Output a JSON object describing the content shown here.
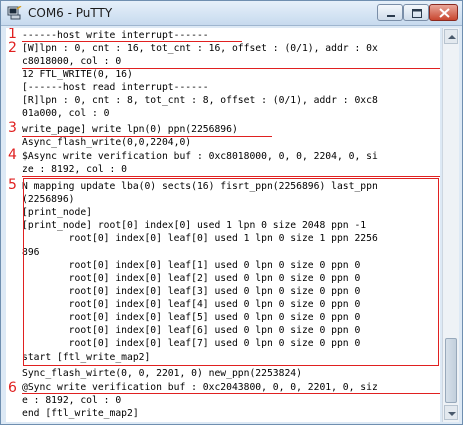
{
  "window": {
    "title": "COM6 - PuTTY"
  },
  "terminal": {
    "lines": [
      "------host write interrupt------",
      "[W]lpn : 0, cnt : 16, tot_cnt : 16, offset : (0/1), addr : 0x",
      "c8018000, col : 0",
      "12 FTL_WRITE(0, 16)",
      "[------host read interrupt------",
      "[R]lpn : 0, cnt : 8, tot_cnt : 8, offset : (0/1), addr : 0xc8",
      "01a000, col : 0",
      "write_page] write lpn(0) ppn(2256896)",
      "Async_flash_write(0,0,2204,0)",
      "$Async write verification buf : 0xc8018000, 0, 0, 2204, 0, si",
      "ze : 8192, col : 0",
      "N mapping update lba(0) sects(16) fisrt_ppn(2256896) last_ppn",
      "(2256896)",
      "[print_node]",
      "[print_node] root[0] index[0] used 1 lpn 0 size 2048 ppn -1",
      "        root[0] index[0] leaf[0] used 1 lpn 0 size 1 ppn 2256",
      "896",
      "        root[0] index[0] leaf[1] used 0 lpn 0 size 0 ppn 0",
      "        root[0] index[0] leaf[2] used 0 lpn 0 size 0 ppn 0",
      "        root[0] index[0] leaf[3] used 0 lpn 0 size 0 ppn 0",
      "        root[0] index[0] leaf[4] used 0 lpn 0 size 0 ppn 0",
      "        root[0] index[0] leaf[5] used 0 lpn 0 size 0 ppn 0",
      "        root[0] index[0] leaf[6] used 0 lpn 0 size 0 ppn 0",
      "        root[0] index[0] leaf[7] used 0 lpn 0 size 0 ppn 0",
      "start [ftl_write_map2]",
      "Sync_flash_wirte(0, 0, 2201, 0) new_ppn(2253824)",
      "@Sync write verification buf : 0xc2043800, 0, 0, 2201, 0, siz",
      "e : 8192, col : 0",
      "end [ftl_write_map2]"
    ]
  },
  "annotations": {
    "markers": [
      "1",
      "2",
      "3",
      "4",
      "5",
      "6"
    ],
    "color": "#e02020"
  }
}
